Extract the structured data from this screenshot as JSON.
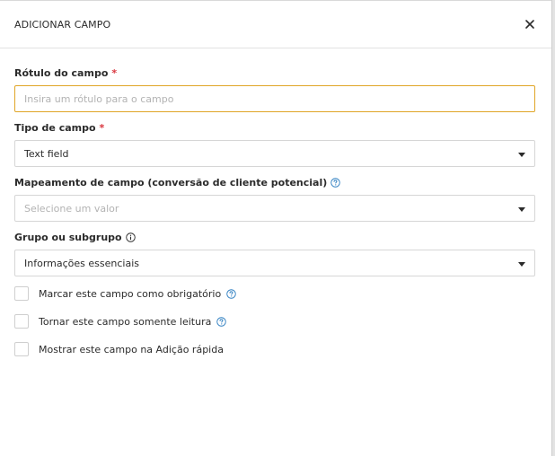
{
  "modal": {
    "title": "ADICIONAR CAMPO",
    "close_icon": "close-icon"
  },
  "fields": {
    "label_field": {
      "label": "Rótulo do campo",
      "required_mark": "*",
      "placeholder": "Insira um rótulo para o campo",
      "value": ""
    },
    "type_field": {
      "label": "Tipo de campo",
      "required_mark": "*",
      "value": "Text field"
    },
    "mapping_field": {
      "label": "Mapeamento de campo (conversão de cliente potencial)",
      "placeholder": "Selecione um valor"
    },
    "group_field": {
      "label": "Grupo ou subgrupo",
      "value": "Informações essenciais"
    }
  },
  "checkboxes": [
    {
      "label": "Marcar este campo como obrigatório",
      "checked": false,
      "has_help": true
    },
    {
      "label": "Tornar este campo somente leitura",
      "checked": false,
      "has_help": true
    },
    {
      "label": "Mostrar este campo na Adição rápida",
      "checked": false,
      "has_help": false
    }
  ],
  "colors": {
    "required": "#d9363e",
    "focus_border": "#e0a526",
    "help_icon": "#2f7fc1"
  }
}
